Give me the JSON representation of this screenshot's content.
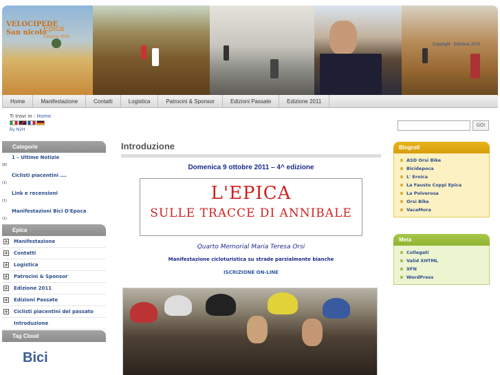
{
  "banner": {
    "site_name": "Epica",
    "edition_label": "Edizione 2010",
    "logo_text_1": "VELOCIPEDE",
    "logo_text_2": "San nicolò",
    "right_text": "Copyright · Edizione 2010"
  },
  "nav": {
    "items": [
      "Home",
      "Manifestazione",
      "Contatti",
      "Logistica",
      "Patrocini & Sponsor",
      "Edizioni Passate",
      "Edizione 2011"
    ]
  },
  "breadcrumb": {
    "prefix": "Ti trovi in :",
    "current": "Home"
  },
  "byline": "By N2H",
  "search": {
    "placeholder": "",
    "button": "GO!"
  },
  "left": {
    "categorie_title": "Categorie",
    "categories": [
      {
        "label": "1 – Ultime Notizie",
        "count": "(8)"
      },
      {
        "label": "Ciclisti piacentini ….",
        "count": "(1)"
      },
      {
        "label": "Link e recensioni",
        "count": "(1)"
      },
      {
        "label": "Manifestazioni Bici D'Epoca",
        "count": "(1)"
      }
    ],
    "epica_title": "Epica",
    "epica_items": [
      {
        "label": "Manifestazione",
        "expandable": true
      },
      {
        "label": "Contatti",
        "expandable": true
      },
      {
        "label": "Logistica",
        "expandable": true
      },
      {
        "label": "Patrocini & Sponsor",
        "expandable": true
      },
      {
        "label": "Edizione 2011",
        "expandable": true
      },
      {
        "label": "Edizioni Passate",
        "expandable": true
      },
      {
        "label": "Ciclisti piacentini del passato",
        "expandable": true
      },
      {
        "label": "Introduzione",
        "expandable": false
      }
    ],
    "expand_glyph": "+",
    "tagcloud_title": "Tag Cloud",
    "tag": "Bici"
  },
  "main": {
    "title": "Introduzione",
    "date": "Domenica 9 ottobre 2011 – 4^ edizione",
    "poster_line1": "L'EPICA",
    "poster_line2": "SULLE TRACCE DI ANNIBALE",
    "memorial": "Quarto Memorial Maria Teresa Orsi",
    "manifestazione": "Manifestazione cicloturistica su strade parzialmente bianche",
    "iscrizione": "ISCRIZIONE ON-LINE"
  },
  "blogroll": {
    "title": "Blogroll",
    "items": [
      "ASD Orsi Bike",
      "Bicidepoca",
      "L' Eroica",
      "La Fausto Coppi Epica",
      "La Polverosa",
      "Orsi Bike",
      "VacaMora"
    ]
  },
  "meta": {
    "title": "Meta",
    "items": [
      "Collegati",
      "Valid XHTML",
      "XFN",
      "WordPress"
    ]
  }
}
